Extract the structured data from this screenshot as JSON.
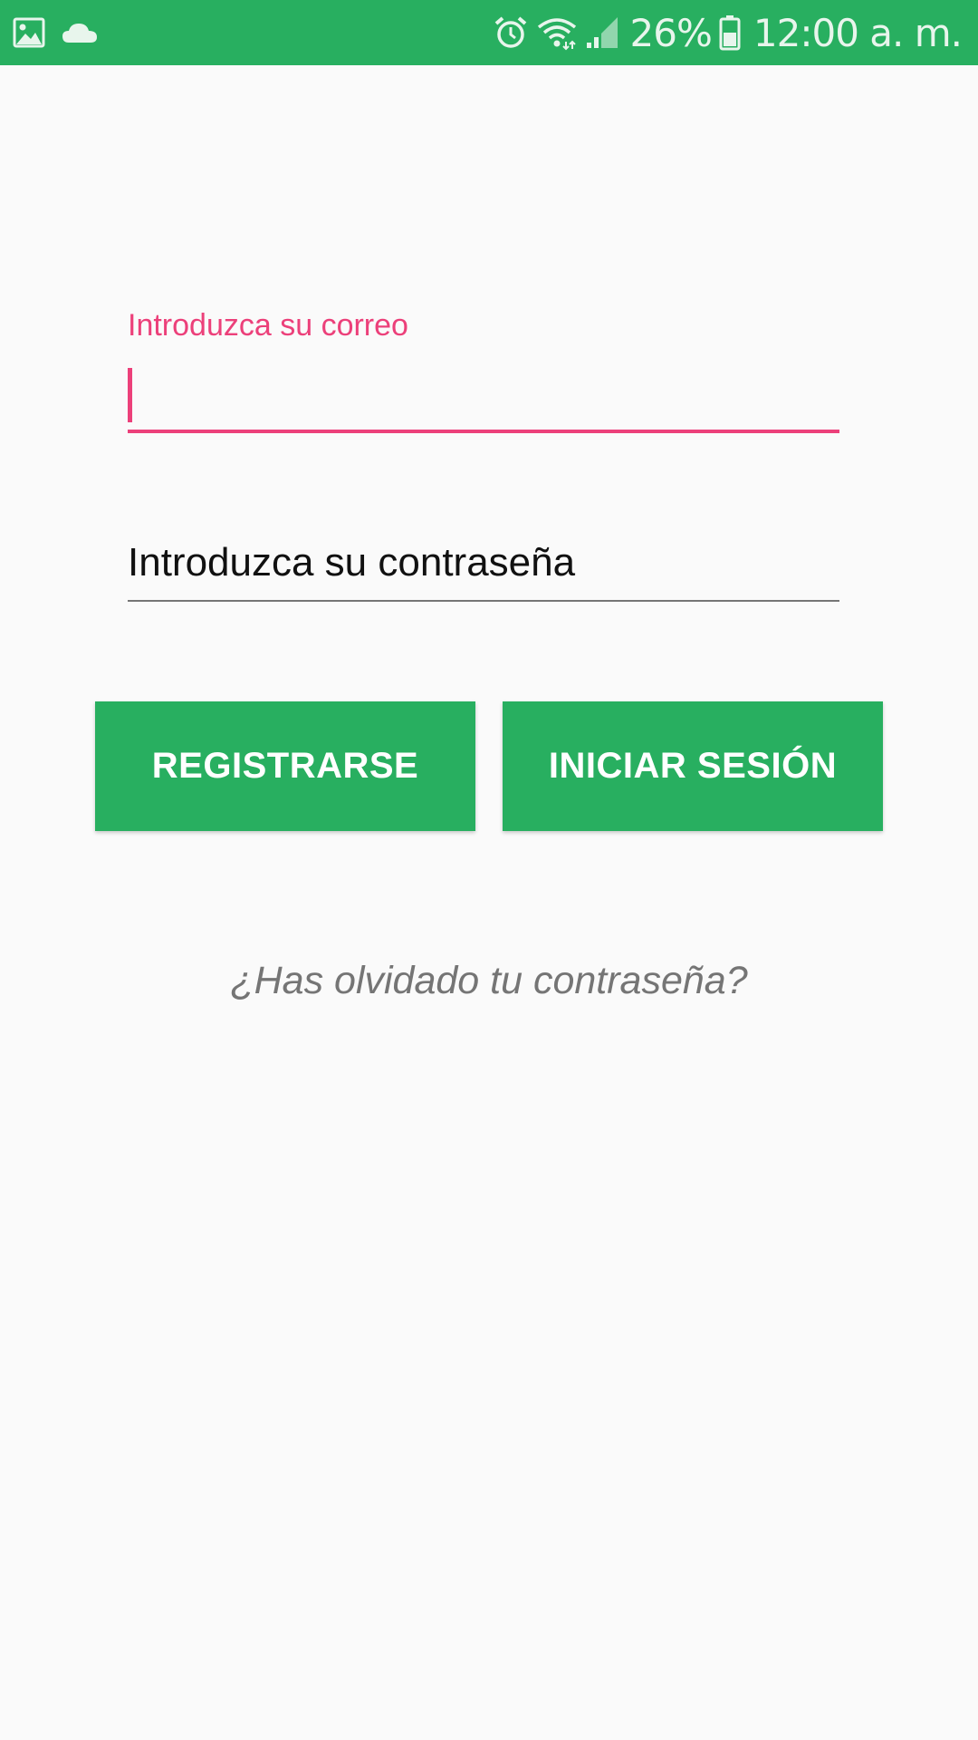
{
  "status_bar": {
    "background_color": "#28af60",
    "left_icons": [
      "image-icon",
      "cloud-icon"
    ],
    "right_icons": [
      "alarm-icon",
      "wifi-icon",
      "signal-icon",
      "battery-icon"
    ],
    "battery_percent": "26%",
    "time": "12:00 a. m."
  },
  "login_form": {
    "email": {
      "label": "Introduzca su correo",
      "value": "",
      "accent_color": "#ec407a"
    },
    "password": {
      "placeholder": "Introduzca su contraseña",
      "value": ""
    },
    "buttons": {
      "register_label": "REGISTRARSE",
      "login_label": "INICIAR SESIÓN",
      "color": "#28af60"
    },
    "forgot_password_link": "¿Has olvidado tu contraseña?"
  }
}
